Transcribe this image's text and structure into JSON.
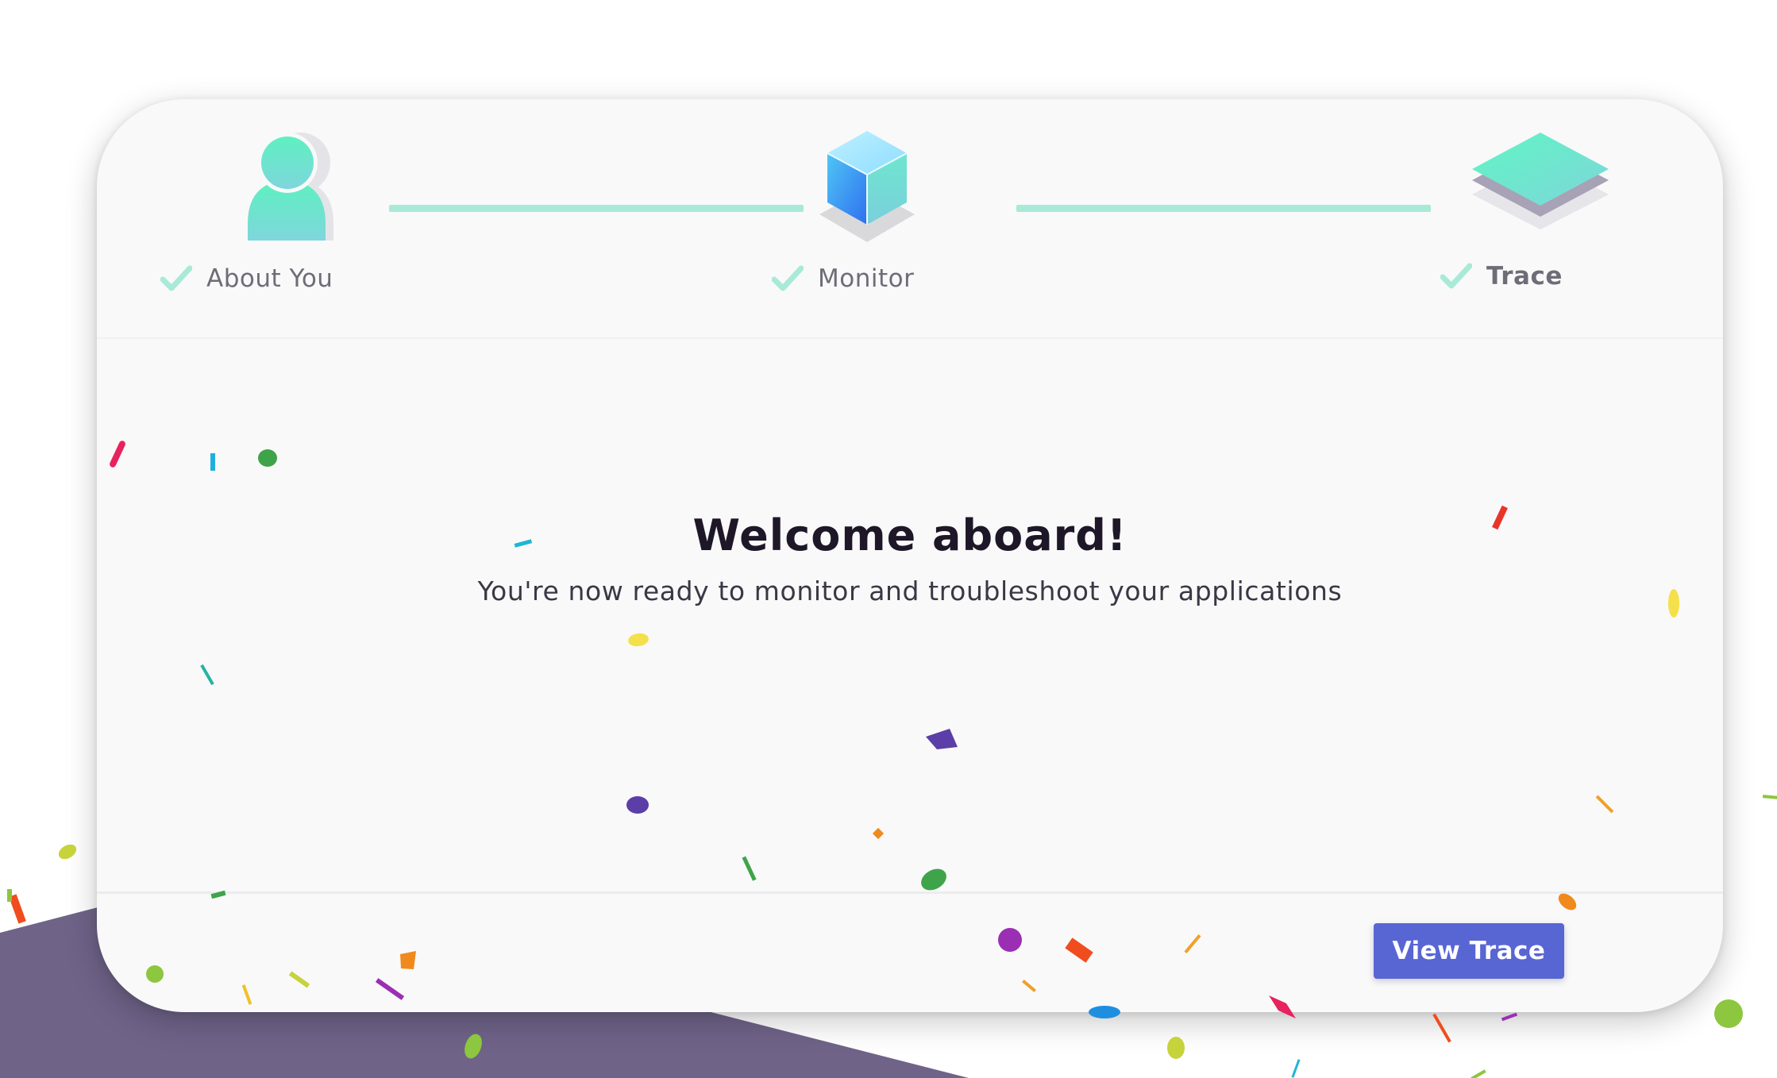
{
  "steps": [
    {
      "label": "About You",
      "icon": "user-avatar-icon",
      "completed": true
    },
    {
      "label": "Monitor",
      "icon": "cube-icon",
      "completed": true
    },
    {
      "label": "Trace",
      "icon": "layers-icon",
      "completed": true
    }
  ],
  "main": {
    "title": "Welcome aboard!",
    "subtitle": "You're now ready to monitor and troubleshoot your applications"
  },
  "footer": {
    "primary_button_label": "View Trace"
  },
  "colors": {
    "accent": "#5866d4",
    "step_connector": "#a8ead7",
    "check": "#a8ead7",
    "background_band": "#6f6388"
  }
}
